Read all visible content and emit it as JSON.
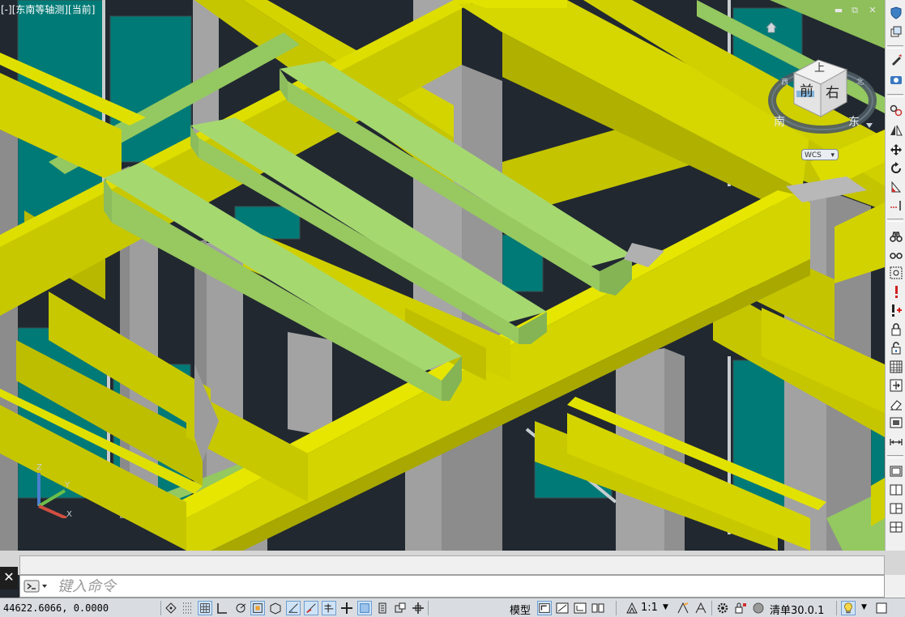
{
  "viewport": {
    "label": "[-][东南等轴测][当前]",
    "window_controls": {
      "minimize": "▬",
      "restore": "⧉",
      "close": "✕"
    }
  },
  "viewcube": {
    "top": "上",
    "front": "前",
    "right": "右",
    "south": "南",
    "east": "东",
    "west": "西",
    "north": "北",
    "wcs": "WCS"
  },
  "ucs": {
    "x": "X",
    "y": "Y",
    "z": "Z"
  },
  "command": {
    "close_label": "✕",
    "placeholder": "键入命令"
  },
  "status": {
    "coordinates": "44622.6066, 0.0000",
    "model_tab": "模型",
    "scale": "1:1",
    "cleanup": "清单30.0.1"
  },
  "colors": {
    "background": "#212830",
    "beam_yellow": "#d4d400",
    "column_gray": "#a0a0a0",
    "slab_green": "#9acd60",
    "glass_teal": "#007a76"
  },
  "icons": {
    "right_toolbar": [
      "shield-icon",
      "copy-view-icon",
      "paint-brush-icon",
      "camera-icon",
      "orbit-icon",
      "mirror-icon",
      "move-icon",
      "rotate-icon",
      "scale-icon",
      "extend-icon",
      "binoculars-icon",
      "glasses-icon",
      "camera-target-icon",
      "warning-icon",
      "warning-plus-icon",
      "lock-icon",
      "lock-open-icon",
      "grid-icon",
      "stretch-icon",
      "eraser-icon",
      "frame-icon",
      "dimension-icon",
      "viewport-single-icon",
      "viewport-double-icon",
      "viewport-three-icon",
      "viewport-four-icon"
    ],
    "status_bar": [
      "snap-icon",
      "grid-icon",
      "grid-display-icon",
      "ortho-icon",
      "polar-icon",
      "osnap-icon",
      "3dosnap-icon",
      "otrack-icon",
      "ducs-icon",
      "dyn-icon",
      "lineweight-icon",
      "transparency-icon",
      "qp-icon",
      "sc-icon",
      "am-icon"
    ]
  }
}
